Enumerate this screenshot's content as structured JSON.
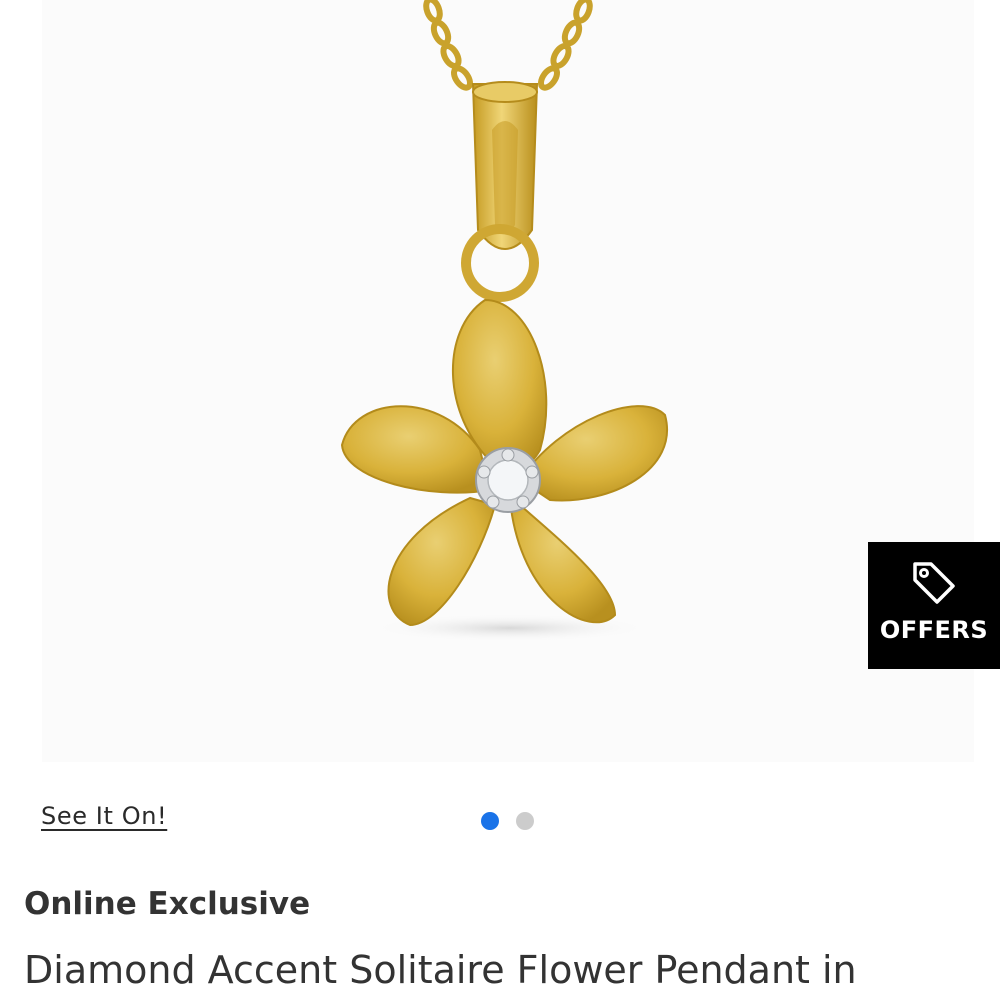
{
  "product_image": {
    "alt": "Diamond Accent Solitaire Flower Pendant",
    "metal_color": "#d9b23a",
    "background_color": "#fbfbfb"
  },
  "offers": {
    "label": "OFFERS",
    "icon": "tag-icon",
    "background_color": "#000000"
  },
  "see_it_on": {
    "label": "See It On!"
  },
  "carousel": {
    "count": 2,
    "active_index": 0,
    "active_color": "#1a73e8",
    "inactive_color": "#cccccc"
  },
  "product": {
    "eyebrow": "Online Exclusive",
    "title": "Diamond Accent Solitaire Flower Pendant in"
  }
}
